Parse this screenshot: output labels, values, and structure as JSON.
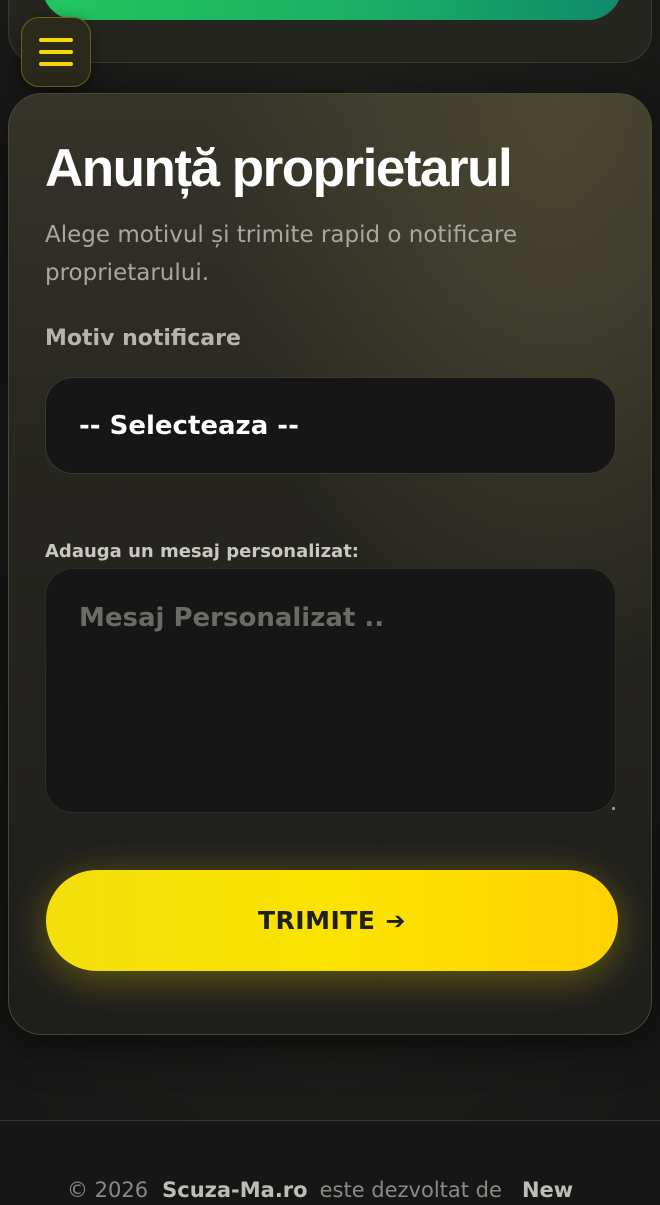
{
  "header": {
    "menu_icon": "hamburger-icon"
  },
  "form": {
    "title": "Anunță proprietarul",
    "subtitle": "Alege motivul și trimite rapid o notificare proprietarului.",
    "reason_label": "Motiv notificare",
    "reason_select_value": "-- Selecteaza --",
    "message_label": "Adauga un mesaj personalizat:",
    "message_placeholder": "Mesaj Personalizat ..",
    "message_value": "",
    "submit_label": "TRIMITE",
    "submit_icon": "arrow-right-icon",
    "submit_arrow": "➔"
  },
  "footer": {
    "copyright": "© 2026",
    "brand": "Scuza-Ma.ro",
    "developed_by": "este dezvoltat de",
    "developer": "New"
  },
  "colors": {
    "accent_yellow": "#fbe300",
    "accent_green": "#22c55e",
    "background": "#161616"
  }
}
